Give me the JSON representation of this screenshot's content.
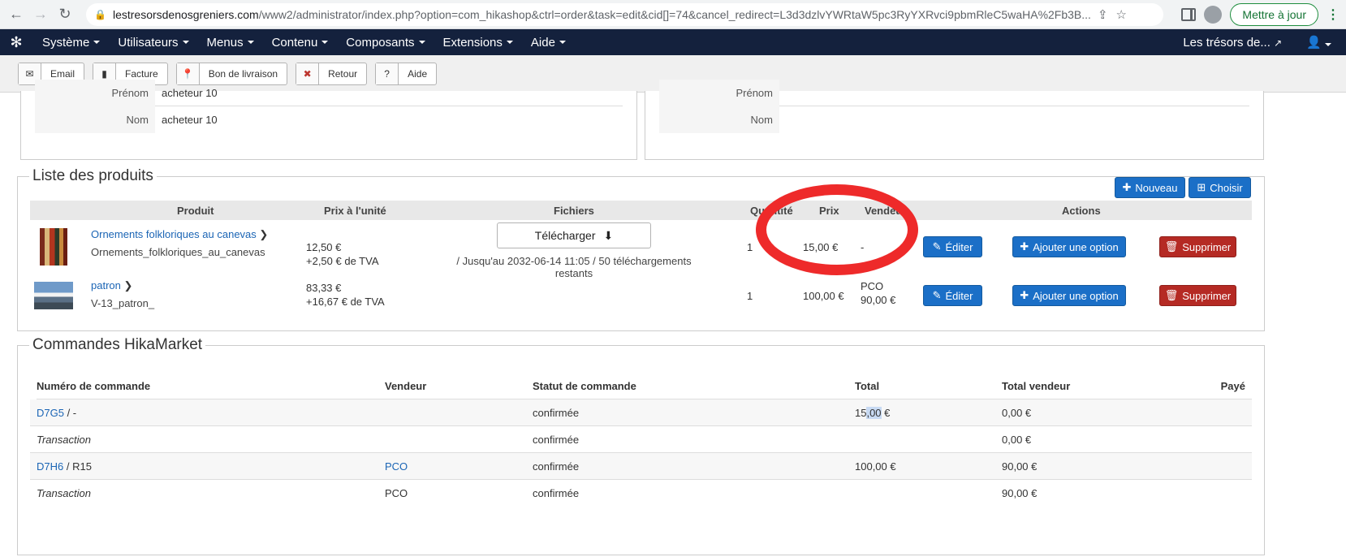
{
  "browser": {
    "host": "lestresorsdenosgreniers.com",
    "path": "/www2/administrator/index.php?option=com_hikashop&ctrl=order&task=edit&cid[]=74&cancel_redirect=L3d3dzlvYWRtaW5pc3RyYXRvci9pbmRleC5waHA%2Fb3B...",
    "update_label": "Mettre à jour"
  },
  "nav": {
    "menus": [
      "Système",
      "Utilisateurs",
      "Menus",
      "Contenu",
      "Composants",
      "Extensions",
      "Aide"
    ],
    "site_name": "Les trésors de..."
  },
  "toolbar": {
    "email": "Email",
    "invoice": "Facture",
    "delivery": "Bon de livraison",
    "return": "Retour",
    "help": "Aide"
  },
  "left_address": {
    "firstname_label": "Prénom",
    "firstname_value": "acheteur 10",
    "lastname_label": "Nom",
    "lastname_value": "acheteur 10"
  },
  "right_address": {
    "firstname_label": "Prénom",
    "lastname_label": "Nom"
  },
  "products": {
    "legend": "Liste des produits",
    "new_label": "Nouveau",
    "choose_label": "Choisir",
    "headers": {
      "product": "Produit",
      "unit_price": "Prix à l'unité",
      "files": "Fichiers",
      "quantity": "Quantité",
      "price": "Prix",
      "vendor": "Vendeur",
      "actions": "Actions"
    },
    "rows": [
      {
        "name": "Ornements folkloriques au canevas",
        "code": "Ornements_folkloriques_au_canevas",
        "unit_price": "12,50 €",
        "tax": "+2,50 € de TVA",
        "download_label": "Télécharger",
        "download_note": "/ Jusqu'au 2032-06-14 11:05 / 50 téléchargements restants",
        "quantity": "1",
        "price": "15,00 €",
        "vendor": "-",
        "vendor_amount": ""
      },
      {
        "name": "patron",
        "code": "V-13_patron_",
        "unit_price": "83,33 €",
        "tax": "+16,67 € de TVA",
        "quantity": "1",
        "price": "100,00 €",
        "vendor": "PCO",
        "vendor_amount": "90,00 €"
      }
    ],
    "edit_label": "Éditer",
    "add_option_label": "Ajouter une option",
    "delete_label": "Supprimer"
  },
  "market": {
    "legend": "Commandes HikaMarket",
    "headers": {
      "number": "Numéro de commande",
      "vendor": "Vendeur",
      "status": "Statut de commande",
      "total": "Total",
      "vendor_total": "Total vendeur",
      "paid": "Payé"
    },
    "rows": [
      {
        "number": "D7G5",
        "suffix": " / -",
        "vendor": "",
        "status": "confirmée",
        "total_a": "15",
        "total_b": ",00",
        "total_c": " €",
        "vendor_total": "0,00 €"
      },
      {
        "number": "Transaction",
        "vendor": "",
        "status": "confirmée",
        "total": "",
        "vendor_total": "0,00 €"
      },
      {
        "number": "D7H6",
        "suffix": " / R15",
        "vendor": "PCO",
        "status": "confirmée",
        "total": "100,00 €",
        "vendor_total": "90,00 €"
      },
      {
        "number": "Transaction",
        "vendor": "PCO",
        "status": "confirmée",
        "total": "",
        "vendor_total": "90,00 €"
      }
    ]
  },
  "colors": {
    "nav_bg": "#14213d",
    "primary": "#1b6fc7",
    "danger": "#b52a24",
    "annotation": "#ee2a2a"
  }
}
